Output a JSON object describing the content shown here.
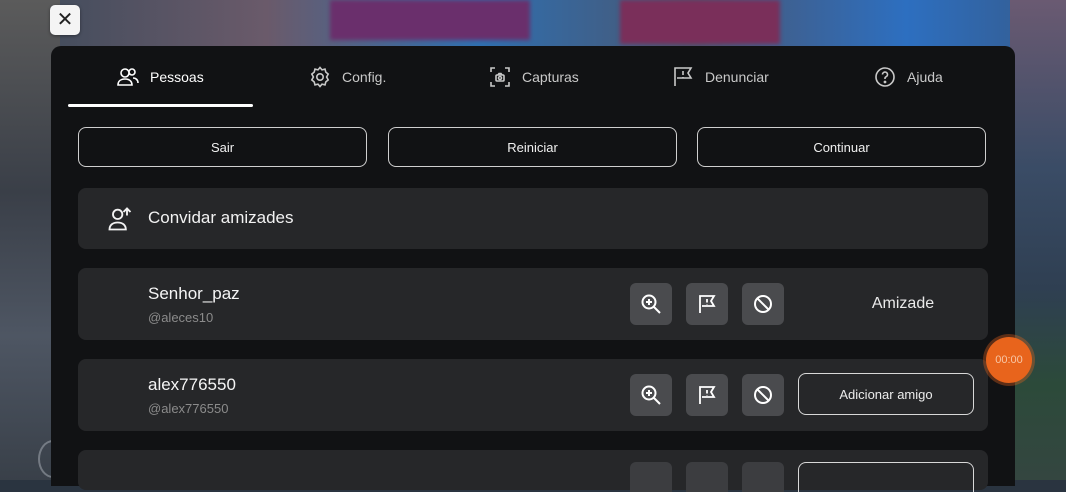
{
  "window": {
    "close_glyph": "✕"
  },
  "tabs": [
    {
      "label": "Pessoas",
      "icon": "people-icon",
      "active": true
    },
    {
      "label": "Config.",
      "icon": "gear-icon",
      "active": false
    },
    {
      "label": "Capturas",
      "icon": "capture-icon",
      "active": false
    },
    {
      "label": "Denunciar",
      "icon": "report-flag-icon",
      "active": false
    },
    {
      "label": "Ajuda",
      "icon": "help-icon",
      "active": false
    }
  ],
  "actions": {
    "leave_label": "Sair",
    "restart_label": "Reiniciar",
    "continue_label": "Continuar"
  },
  "invite": {
    "label": "Convidar amizades",
    "icon": "add-person-icon"
  },
  "players": [
    {
      "name": "Senhor_paz",
      "handle": "@aleces10",
      "status": "Amizade"
    },
    {
      "name": "alex776550",
      "handle": "@alex776550",
      "action_label": "Adicionar amigo"
    }
  ],
  "player_icons": [
    "inspect-zoom-icon",
    "report-flag-icon",
    "block-icon"
  ],
  "recording": {
    "timer": "00:00",
    "color": "#e8641c"
  },
  "colors": {
    "panel": "#111214",
    "row": "#262729",
    "icon_button": "#4a4b4e"
  }
}
